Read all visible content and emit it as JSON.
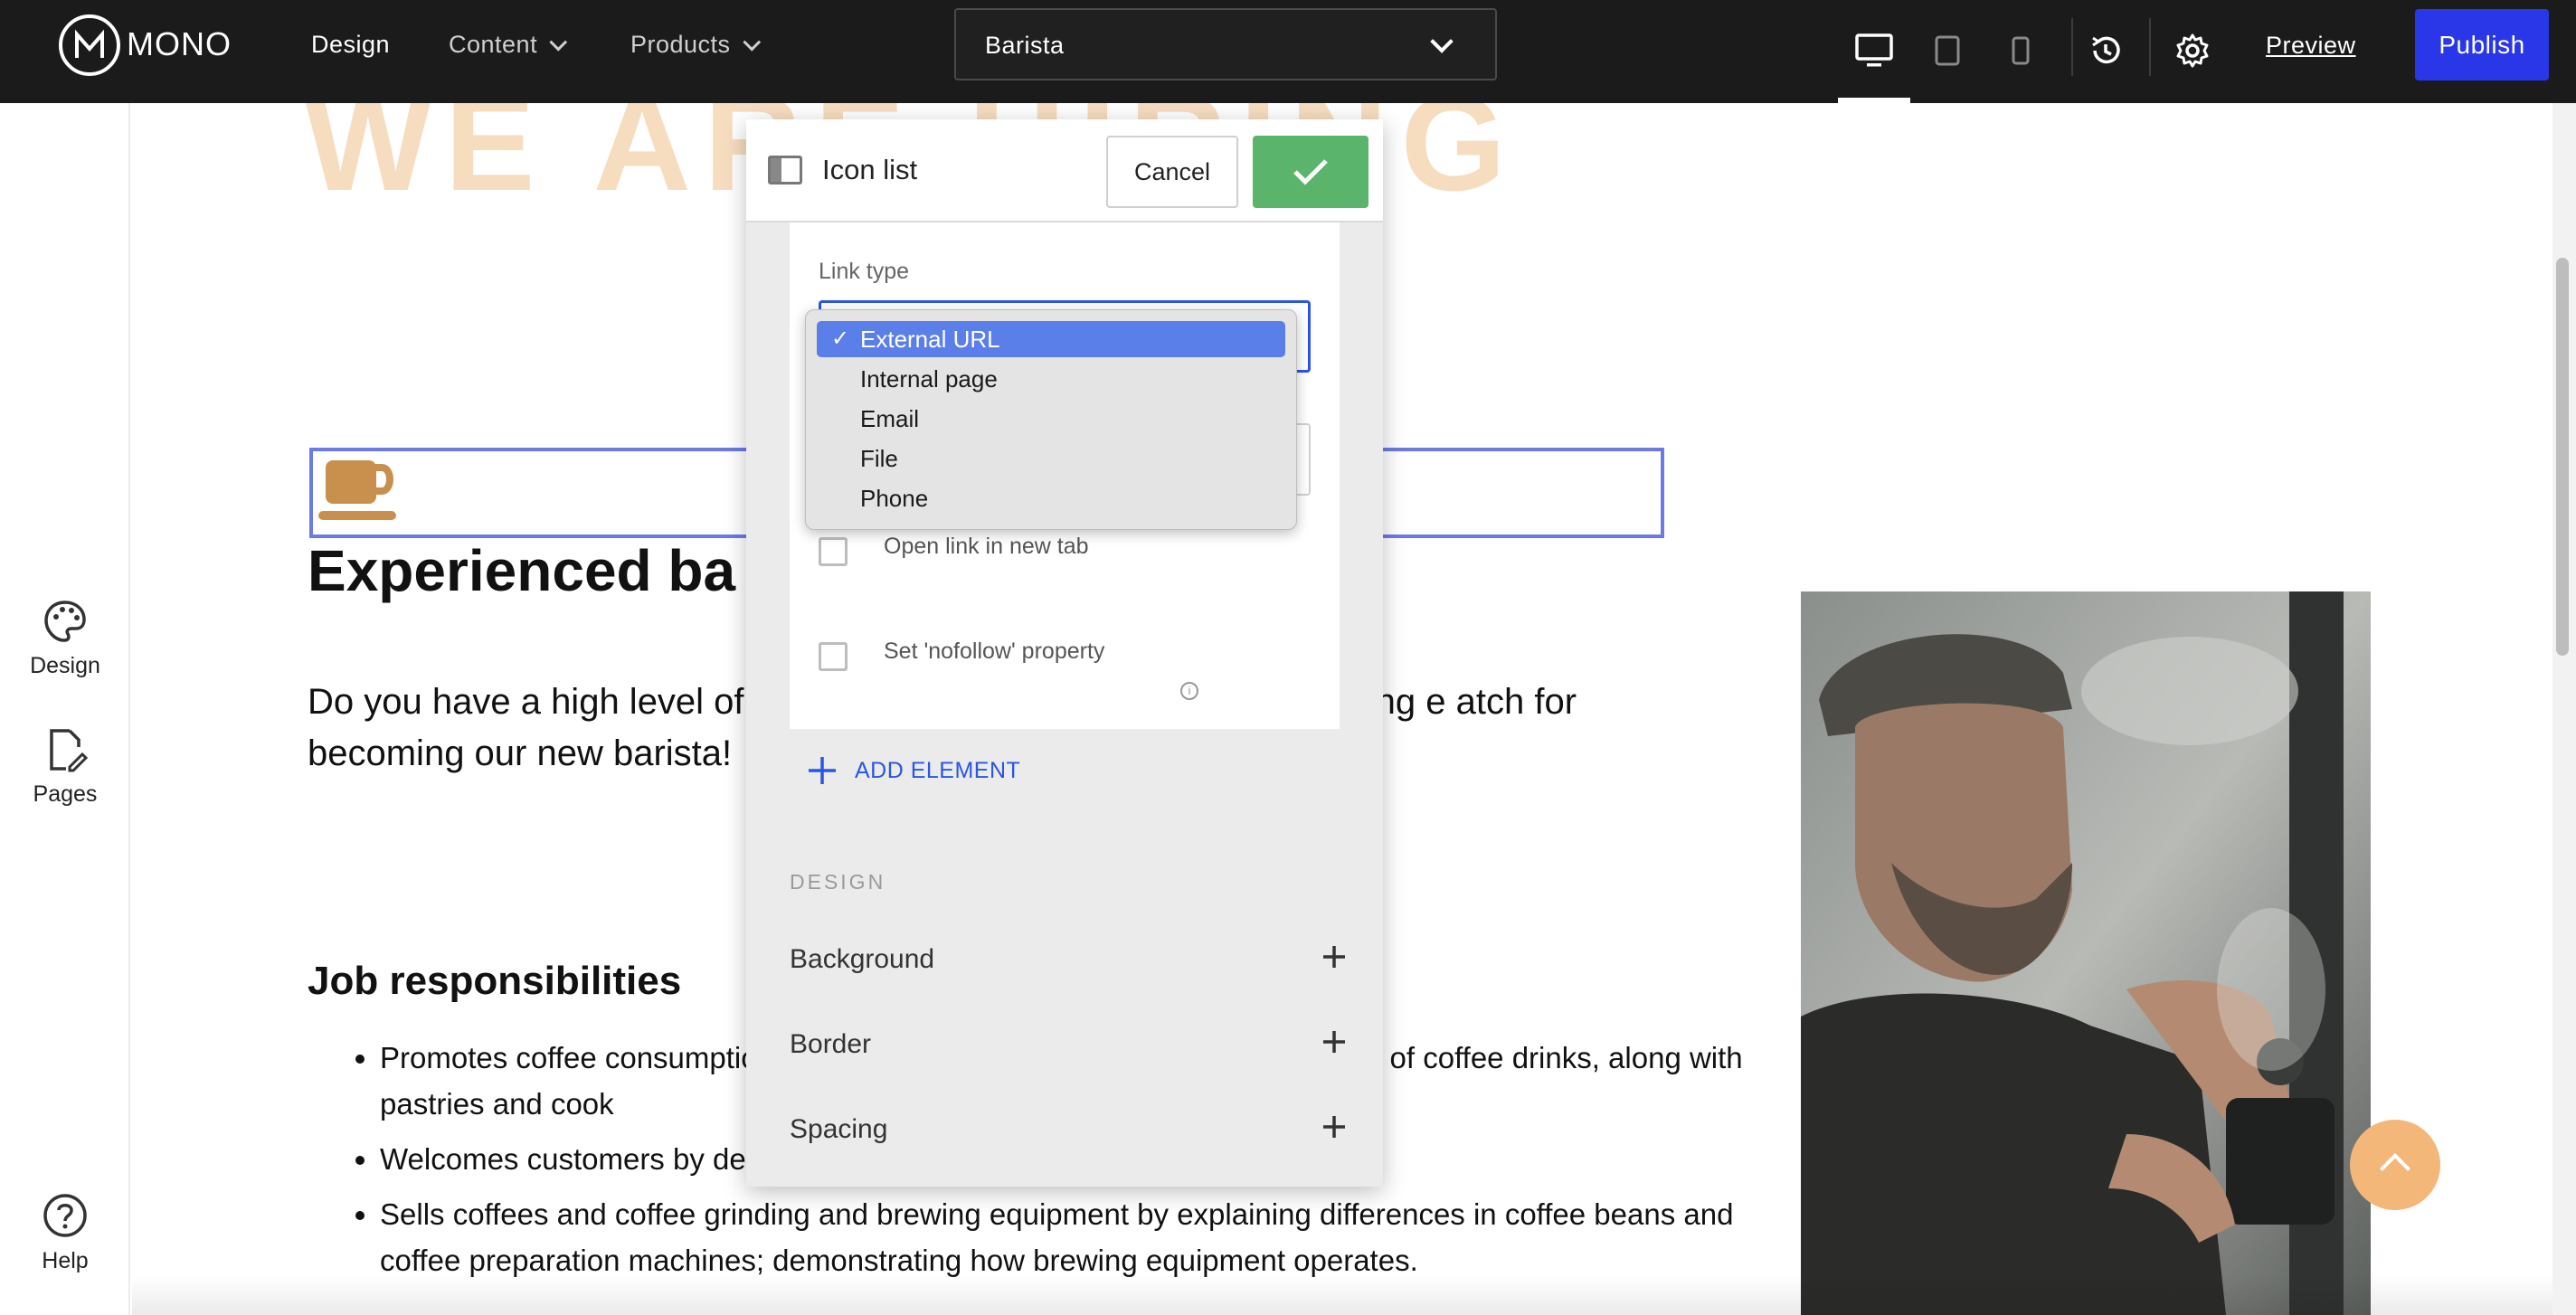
{
  "topbar": {
    "logo_text": "MONO",
    "nav": {
      "design": "Design",
      "content": "Content",
      "products": "Products"
    },
    "page_selector": "Barista",
    "preview": "Preview",
    "publish": "Publish"
  },
  "sidebar": {
    "design": "Design",
    "pages": "Pages",
    "help": "Help"
  },
  "canvas": {
    "banner_text": "WE ARE HIRING",
    "heading": "Experienced ba",
    "paragraph": "Do you have a high level of                                                       e making skills and good customer facing e                                                        atch for becoming our new barista!",
    "job_heading": "Job responsibilities",
    "bullets": [
      "Promotes coffee consumptio                                                           ee grinding and brewing equipment, accesso                                                         y of coffee drinks, along with pastries and cook",
      "Welcomes customers by determining their coffee interests and needs.",
      "Sells coffees and coffee grinding and brewing equipment by explaining differences in coffee beans and coffee preparation machines; demonstrating how brewing equipment operates."
    ]
  },
  "modal": {
    "title": "Icon list",
    "cancel": "Cancel",
    "link_type_label": "Link type",
    "open_new_tab": "Open link in new tab",
    "nofollow": "Set 'nofollow' property",
    "add_element": "ADD ELEMENT",
    "design_section": "DESIGN",
    "accordions": [
      "Background",
      "Border",
      "Spacing"
    ]
  },
  "dropdown": {
    "options": [
      "External URL",
      "Internal page",
      "Email",
      "File",
      "Phone"
    ],
    "selected": "External URL"
  },
  "colors": {
    "publish": "#2a37e8",
    "ok": "#5ab46b",
    "accent_blue": "#2a55e6",
    "selection": "#5b7fe8",
    "icon_cup": "#c9904d",
    "scroll_up": "#f3b77a"
  }
}
